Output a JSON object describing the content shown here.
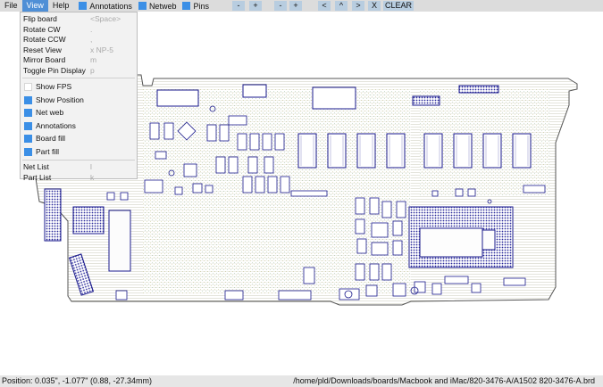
{
  "menubar": {
    "file": "File",
    "view": "View",
    "help": "Help",
    "toggles": [
      {
        "label": "Annotations",
        "checked": true
      },
      {
        "label": "Netweb",
        "checked": true
      },
      {
        "label": "Pins",
        "checked": true
      }
    ],
    "zoom_out": "-",
    "zoom_in": "+",
    "minus2": "-",
    "plus2": "+",
    "nav_left": "<",
    "nav_up": "^",
    "nav_right": ">",
    "x_btn": "X",
    "clear_btn": "CLEAR"
  },
  "view_menu": {
    "items": [
      {
        "label": "Flip board",
        "shortcut": "<Space>"
      },
      {
        "label": "Rotate CW",
        "shortcut": "."
      },
      {
        "label": "Rotate CCW",
        "shortcut": ","
      },
      {
        "label": "Reset View",
        "shortcut": "x NP-5"
      },
      {
        "label": "Mirror Board",
        "shortcut": "m"
      },
      {
        "label": "Toggle Pin Display",
        "shortcut": "p"
      }
    ],
    "toggles": [
      {
        "label": "Show FPS",
        "checked": false
      },
      {
        "label": "Show Position",
        "checked": true
      },
      {
        "label": "Net web",
        "checked": true
      },
      {
        "label": "Annotations",
        "checked": true
      },
      {
        "label": "Board fill",
        "checked": true
      },
      {
        "label": "Part fill",
        "checked": true
      }
    ],
    "lists": [
      {
        "label": "Net List",
        "shortcut": "l"
      },
      {
        "label": "Part List",
        "shortcut": "k"
      }
    ]
  },
  "status": {
    "position": "Position: 0.035\", -1.077\" (0.88, -27.34mm)",
    "file_path": "/home/pld/Downloads/boards/Macbook and iMac/820-3476-A/A1502 820-3476-A.brd"
  },
  "colors": {
    "accent": "#3b8fe6",
    "board_outline": "#555555",
    "components": "#1a1a8c",
    "traces": "#9aa06a"
  }
}
